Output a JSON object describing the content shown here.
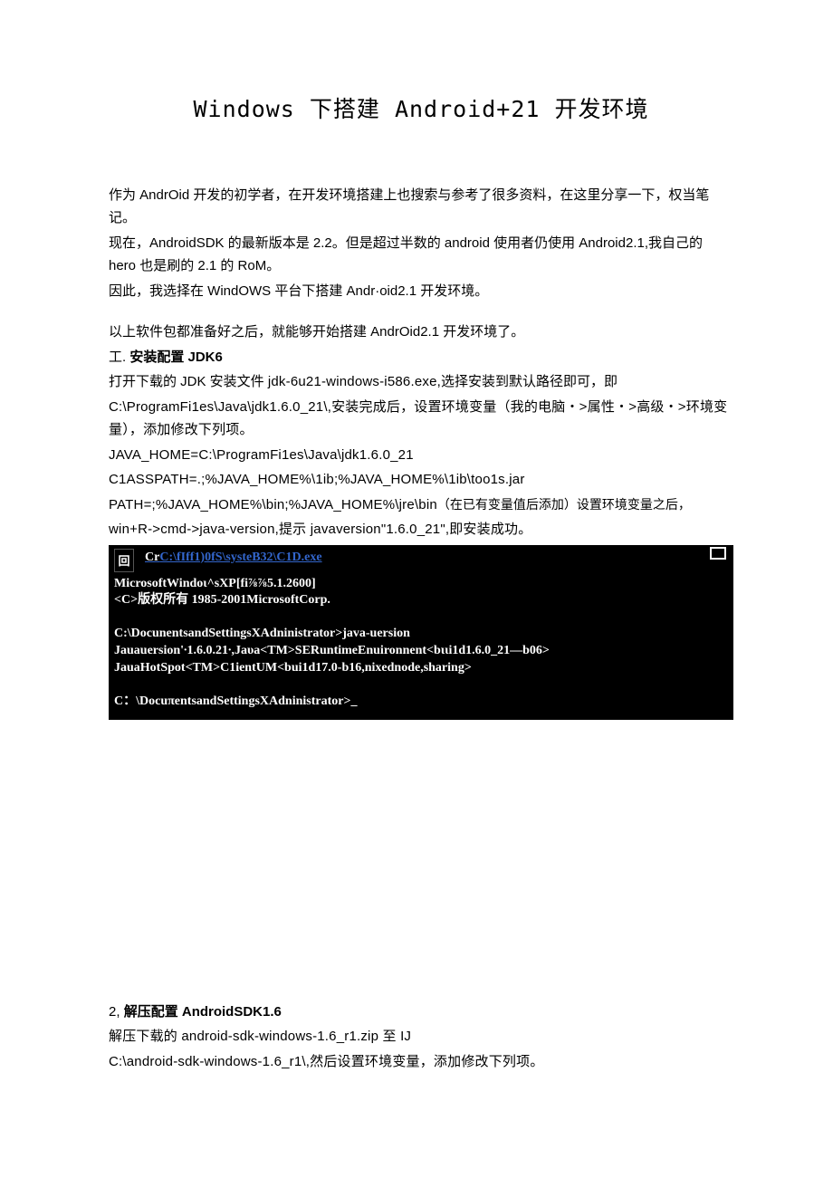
{
  "title": "Windows 下搭建 Android+21 开发环境",
  "intro": {
    "p1": "作为 AndrOid 开发的初学者，在开发环境搭建上也搜索与参考了很多资料，在这里分享一下，权当笔记。",
    "p2": "现在，AndroidSDK 的最新版本是 2.2。但是超过半数的 android 使用者仍使用 Android2.1,我自己的 hero 也是刷的 2.1 的 RoM。",
    "p3": "因此，我选择在 WindOWS 平台下搭建 Andr·oid2.1 开发环境。",
    "p4": "以上软件包都准备好之后，就能够开始搭建 AndrOid2.1 开发环境了。"
  },
  "section1": {
    "label_prefix": "工. ",
    "label_bold": "安装配置 JDK6",
    "p1_pre": "打开下载的 JDK 安装文件 ",
    "p1_file": "jdk-6u21-windows-i586.exe,",
    "p1_post": "选择安装到默认路径即可，即",
    "p2": "C:\\ProgramFi1es\\Java\\jdk1.6.0_21\\,安装完成后，设置环境变量（我的电脑・>属性・>高级・>环境变量），添加修改下列项。",
    "env1": "JAVA_HOME=C:\\ProgramFi1es\\Java\\jdk1.6.0_21",
    "env2": "C1ASSPATH=.;%JAVA_HOME%\\1ib;%JAVA_HOME%\\1ib\\too1s.jar",
    "env3_a": "PATH=;%JAVA_HOME%\\bin;%JAVA_HOME%\\jre\\bin",
    "env3_b": "（在已有变量值后添加）设置环境变量之后，",
    "p3": "win+R->cmd->java-version,提示 javaversion\"1.6.0_21\",即安装成功。"
  },
  "terminal": {
    "back_icon": "回",
    "title_prefix": "Cr",
    "title_path": "C:\\fIff1)0fS\\systeB32\\C1D.exe",
    "l1": "MicrosoftWindoι^sXP[fi⅞⅞5.1.2600]",
    "l2": "<C>版权所有 1985-2001MicrosoftCorp.",
    "l3": "C:\\DocunentsandSettingsXAdninistrator>java-uersion",
    "l4": "Jauauersion'∙1.6.0.21∙,Jaυa<TM>SERuntimeEnuironnent<bιιi1d1.6.0_21—b06>",
    "l5": "JauaHotSpot<TM>C1ientUM<bui1d17.0-b16,nixednode,sharing>",
    "l6": "C：\\DocuπentsandSettingsXAdninistrator>_"
  },
  "section2": {
    "label_prefix": "2, ",
    "label_bold": "解压配置 AndroidSDK1.6",
    "p1": "解压下载的 android-sdk-windows-1.6_r1.zip 至 IJ",
    "p2": "C:\\android-sdk-windows-1.6_r1\\,然后设置环境变量，添加修改下列项。"
  }
}
